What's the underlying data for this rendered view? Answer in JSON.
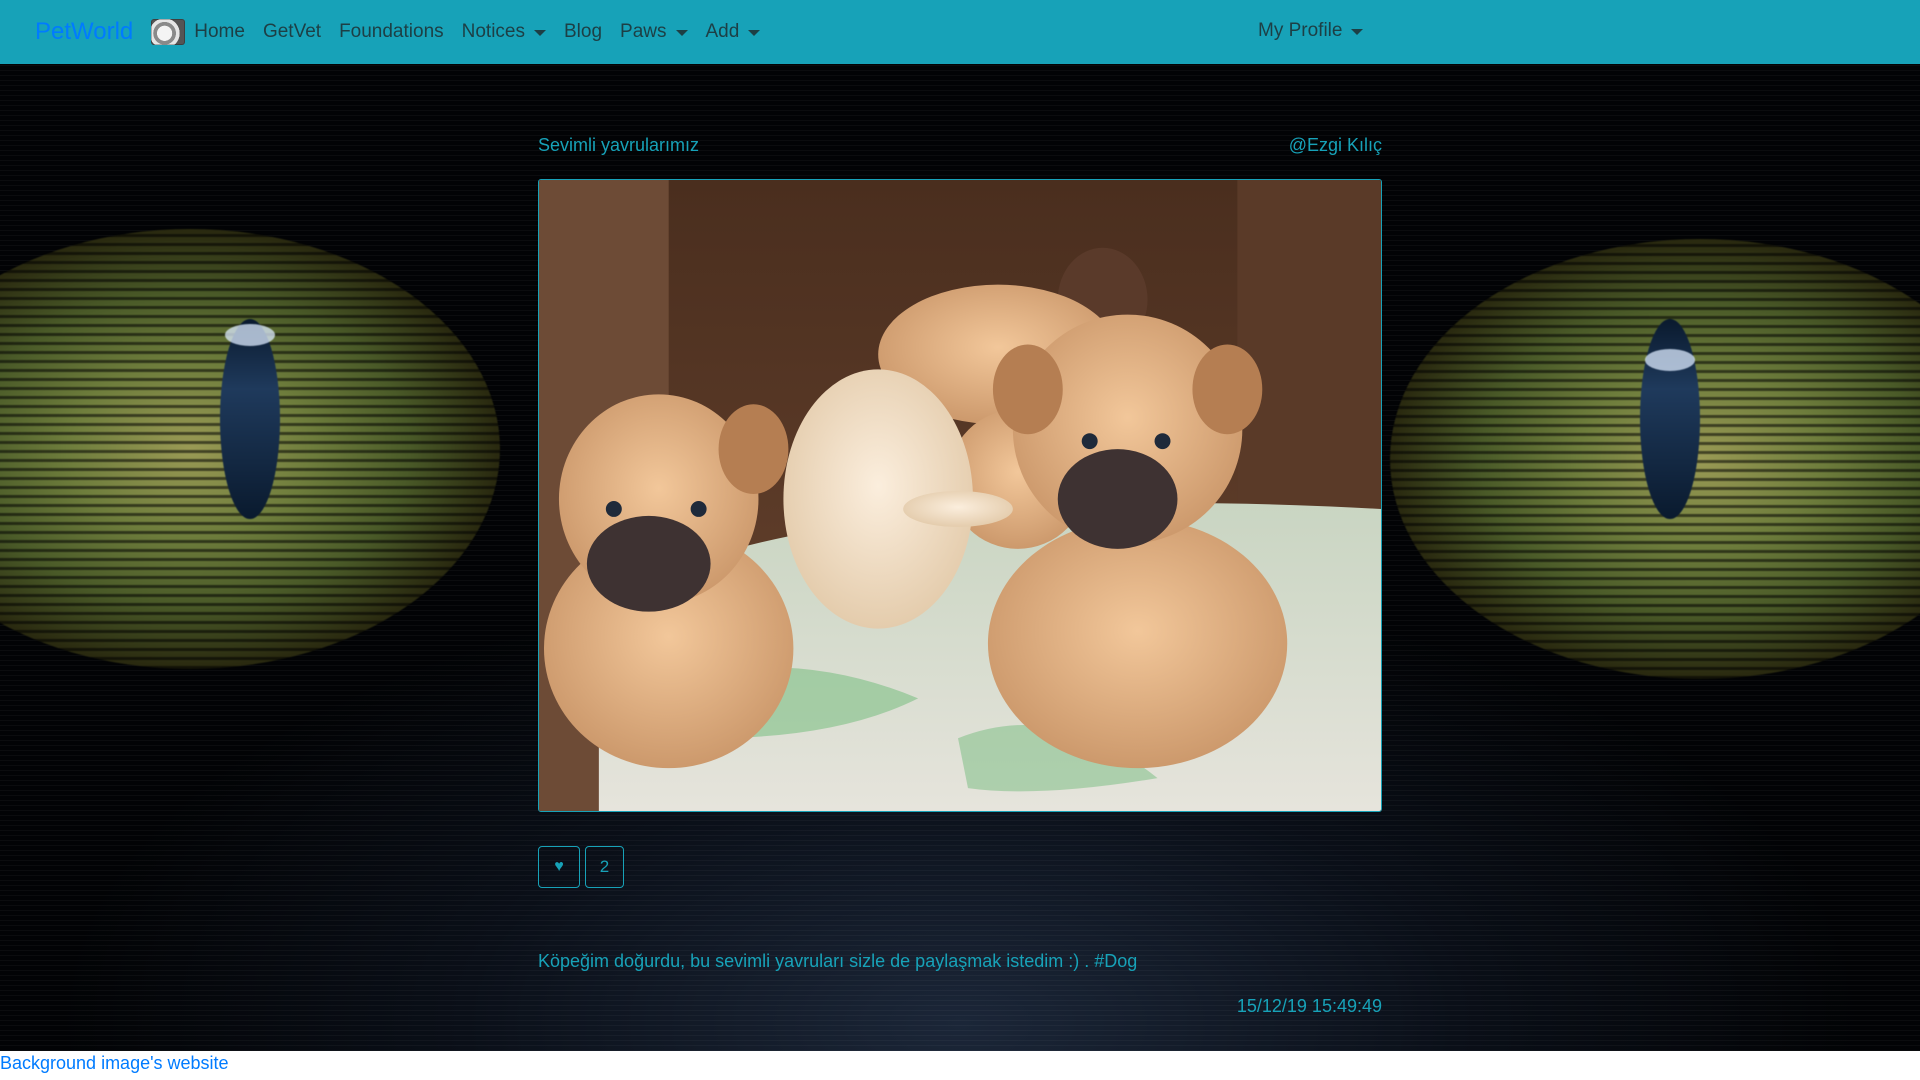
{
  "navbar": {
    "brand": "PetWorld",
    "items": [
      {
        "label": "Home",
        "dropdown": false
      },
      {
        "label": "GetVet",
        "dropdown": false
      },
      {
        "label": "Foundations",
        "dropdown": false
      },
      {
        "label": "Notices",
        "dropdown": true
      },
      {
        "label": "Blog",
        "dropdown": false
      },
      {
        "label": "Paws",
        "dropdown": true
      },
      {
        "label": "Add",
        "dropdown": true
      }
    ],
    "profile": "My Profile",
    "bg_color": "#17a2b8",
    "brand_color": "#007bff"
  },
  "post": {
    "title": "Sevimli yavrularımız",
    "author": "@Ezgi Kılıç",
    "image_alt": "puppies-photo",
    "like_icon": "heart-icon",
    "like_glyph": "♥",
    "like_count": "2",
    "text": "Köpeğim doğurdu, bu sevimli yavruları sizle de paylaşmak istedim :) . #Dog",
    "date": "15/12/19 15:49:49",
    "accent_color": "#17a2b8"
  },
  "footer": {
    "link": "Background image's website"
  }
}
